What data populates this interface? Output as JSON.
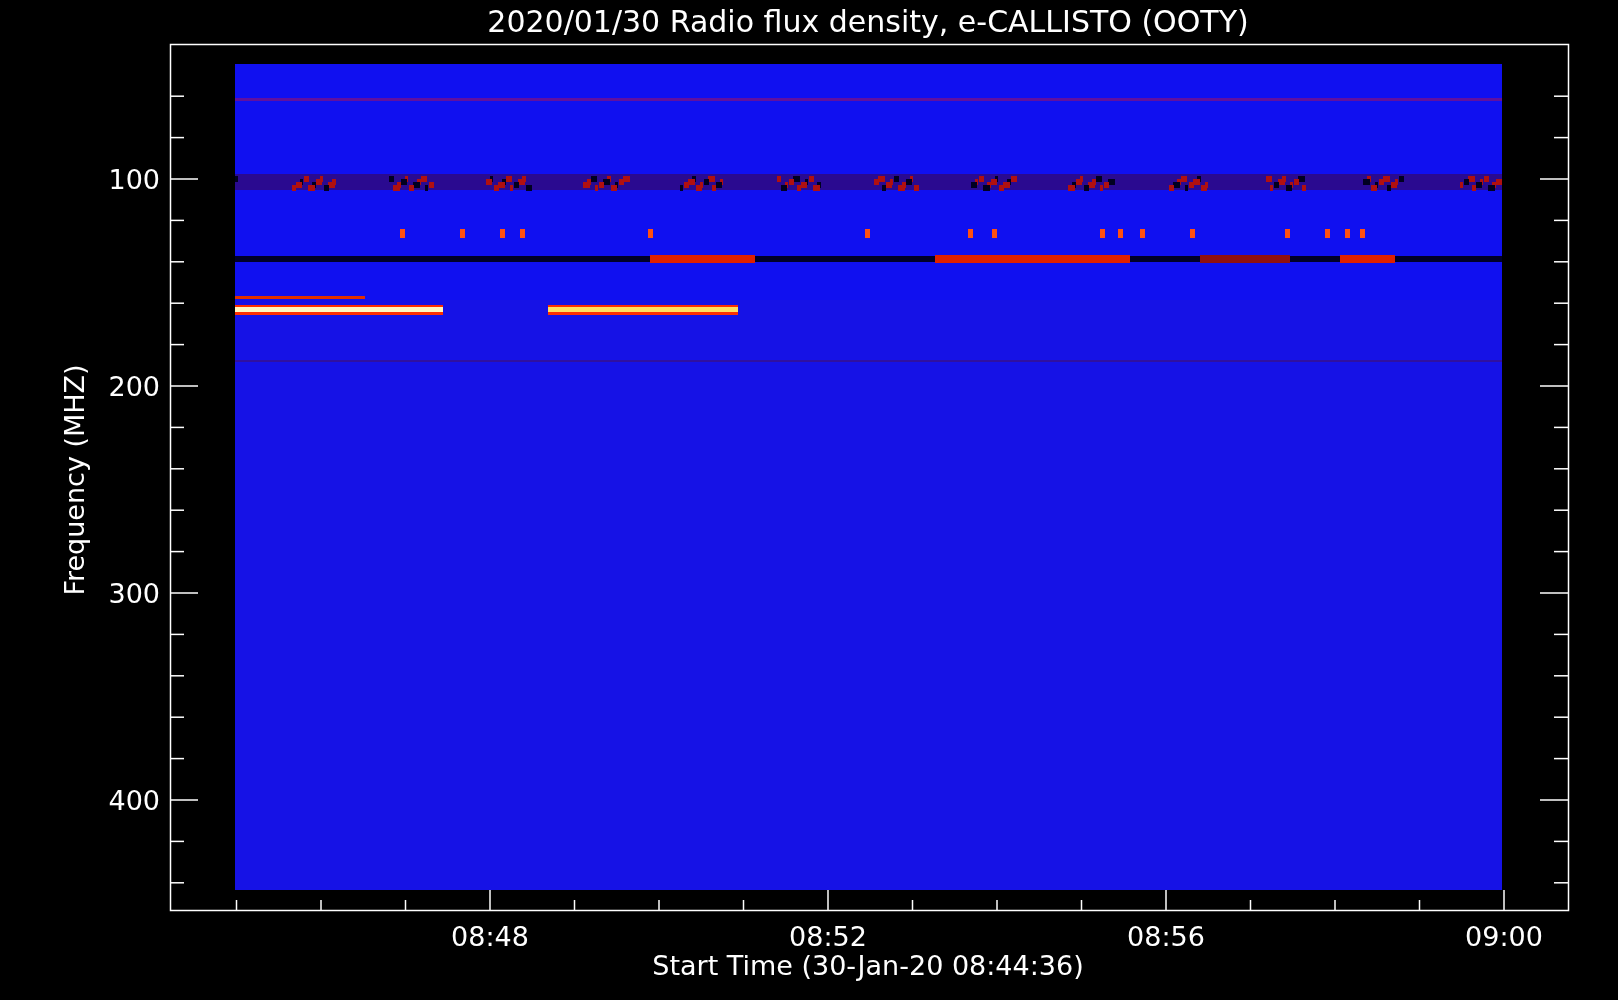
{
  "title": "2020/01/30  Radio flux density, e-CALLISTO (OOTY)",
  "xlabel": "Start Time (30-Jan-20 08:44:36)",
  "ylabel": "Frequency (MHZ)",
  "xticks": [
    "08:48",
    "08:52",
    "08:56",
    "09:00"
  ],
  "yticks": [
    "100",
    "200",
    "300",
    "400"
  ]
}
